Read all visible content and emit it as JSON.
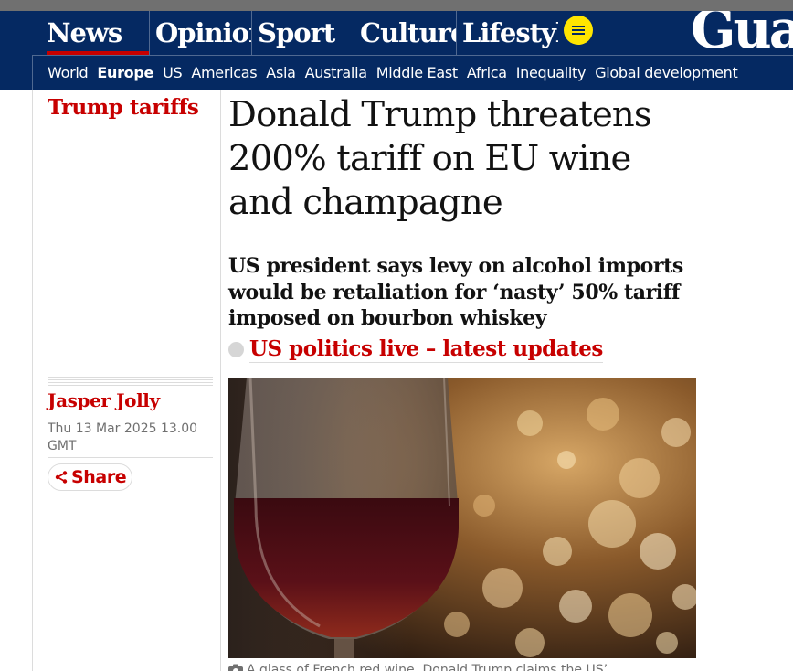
{
  "nav": {
    "pillars": [
      "News",
      "Opinion",
      "Sport",
      "Culture",
      "Lifestyle"
    ],
    "active_pillar": "News",
    "logo_text": "Guardian",
    "subnav": [
      "World",
      "Europe",
      "US",
      "Americas",
      "Asia",
      "Australia",
      "Middle East",
      "Africa",
      "Inequality",
      "Global development"
    ],
    "current_subnav": "Europe"
  },
  "article": {
    "series_tag": "Trump tariffs",
    "headline": "Donald Trump threatens 200% tariff on EU wine and champagne",
    "standfirst": "US president says levy on alcohol imports would be retaliation for ‘nasty’ 50% tariff imposed on bourbon whiskey",
    "live_link": "US politics live – latest updates",
    "author": "Jasper Jolly",
    "date": "Thu 13 Mar 2025 13.00 GMT",
    "share_label": "Share",
    "caption": "A glass of French red wine. Donald Trump claims the US’"
  },
  "colors": {
    "brand_blue": "#052962",
    "news_red": "#c70000",
    "menu_yellow": "#ffe500"
  }
}
